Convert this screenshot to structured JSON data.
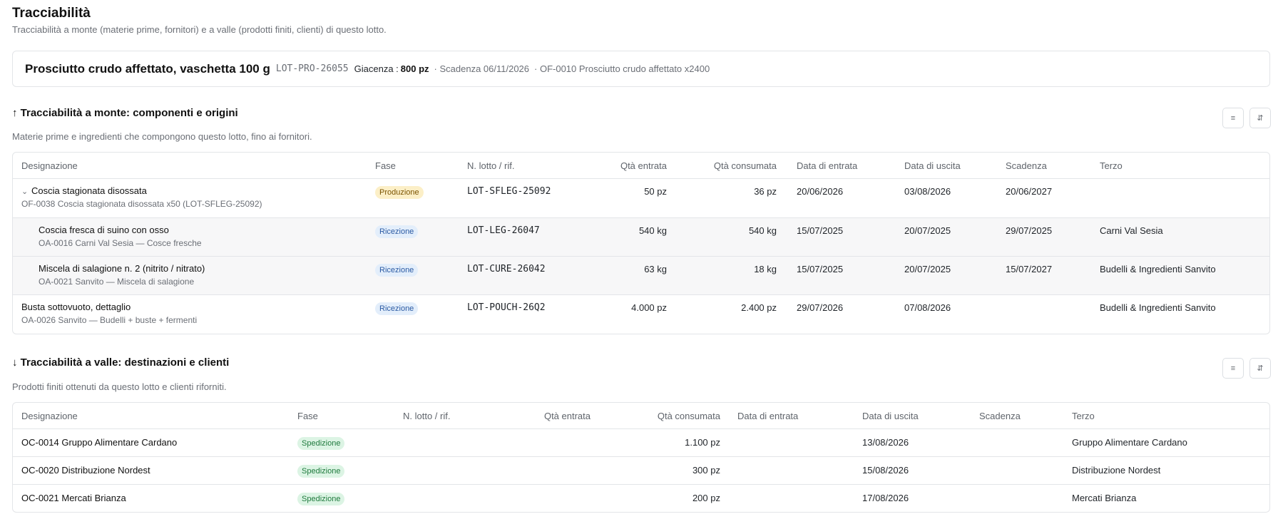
{
  "page": {
    "title": "Tracciabilità",
    "subtitle": "Tracciabilità a monte (materie prime, fornitori) e a valle (prodotti finiti, clienti) di questo lotto."
  },
  "lot": {
    "name": "Prosciutto crudo affettato, vaschetta 100 g",
    "code": "LOT-PRO-26055",
    "stock_label": "Giacenza :",
    "stock_value": "800 pz",
    "expiry": "· Scadenza 06/11/2026",
    "order": "· OF-0010 Prosciutto crudo affettato x2400"
  },
  "upstream": {
    "title": "↑ Tracciabilità a monte: componenti e origini",
    "subtitle": "Materie prime e ingredienti che compongono questo lotto, fino ai fornitori.",
    "toolbar": {
      "list_icon": "≡",
      "sort_icon": "⇵"
    },
    "columns": [
      "Designazione",
      "Fase",
      "N. lotto / rif.",
      "Qtà entrata",
      "Qtà consumata",
      "Data di entrata",
      "Data di uscita",
      "Scadenza",
      "Terzo"
    ],
    "rows": [
      {
        "name": "Coscia stagionata disossata",
        "sub": "OF-0038 Coscia stagionata disossata x50 (LOT-SFLEG-25092)",
        "phase": "Produzione",
        "lot": "LOT-SFLEG-25092",
        "qty_in": "50 pz",
        "qty_used": "36 pz",
        "date_in": "20/06/2026",
        "date_out": "03/08/2026",
        "expiry": "20/06/2027",
        "party": ""
      },
      {
        "name": "Coscia fresca di suino con osso",
        "sub": "OA-0016 Carni Val Sesia — Cosce fresche",
        "phase": "Ricezione",
        "lot": "LOT-LEG-26047",
        "qty_in": "540 kg",
        "qty_used": "540 kg",
        "date_in": "15/07/2025",
        "date_out": "20/07/2025",
        "expiry": "29/07/2025",
        "party": "Carni Val Sesia"
      },
      {
        "name": "Miscela di salagione n. 2 (nitrito / nitrato)",
        "sub": "OA-0021 Sanvito — Miscela di salagione",
        "phase": "Ricezione",
        "lot": "LOT-CURE-26042",
        "qty_in": "63 kg",
        "qty_used": "18 kg",
        "date_in": "15/07/2025",
        "date_out": "20/07/2025",
        "expiry": "15/07/2027",
        "party": "Budelli & Ingredienti Sanvito"
      },
      {
        "name": "Busta sottovuoto, dettaglio",
        "sub": "OA-0026 Sanvito — Budelli + buste + fermenti",
        "phase": "Ricezione",
        "lot": "LOT-POUCH-26Q2",
        "qty_in": "4.000 pz",
        "qty_used": "2.400 pz",
        "date_in": "29/07/2026",
        "date_out": "07/08/2026",
        "expiry": "",
        "party": "Budelli & Ingredienti Sanvito"
      }
    ]
  },
  "downstream": {
    "title": "↓ Tracciabilità a valle: destinazioni e clienti",
    "subtitle": "Prodotti finiti ottenuti da questo lotto e clienti riforniti.",
    "toolbar": {
      "list_icon": "≡",
      "sort_icon": "⇵"
    },
    "columns": [
      "Designazione",
      "Fase",
      "N. lotto / rif.",
      "Qtà entrata",
      "Qtà consumata",
      "Data di entrata",
      "Data di uscita",
      "Scadenza",
      "Terzo"
    ],
    "rows": [
      {
        "name": "OC-0014 Gruppo Alimentare Cardano",
        "phase": "Spedizione",
        "qty_used": "1.100 pz",
        "date_out": "13/08/2026",
        "party": "Gruppo Alimentare Cardano"
      },
      {
        "name": "OC-0020 Distribuzione Nordest",
        "phase": "Spedizione",
        "qty_used": "300 pz",
        "date_out": "15/08/2026",
        "party": "Distribuzione Nordest"
      },
      {
        "name": "OC-0021 Mercati Brianza",
        "phase": "Spedizione",
        "qty_used": "200 pz",
        "date_out": "17/08/2026",
        "party": "Mercati Brianza"
      }
    ]
  },
  "colors": {
    "badge_production": "#fcefc7",
    "badge_reception": "#e3eefb",
    "badge_shipping": "#dcf4e4",
    "border": "#e3e5e8"
  }
}
